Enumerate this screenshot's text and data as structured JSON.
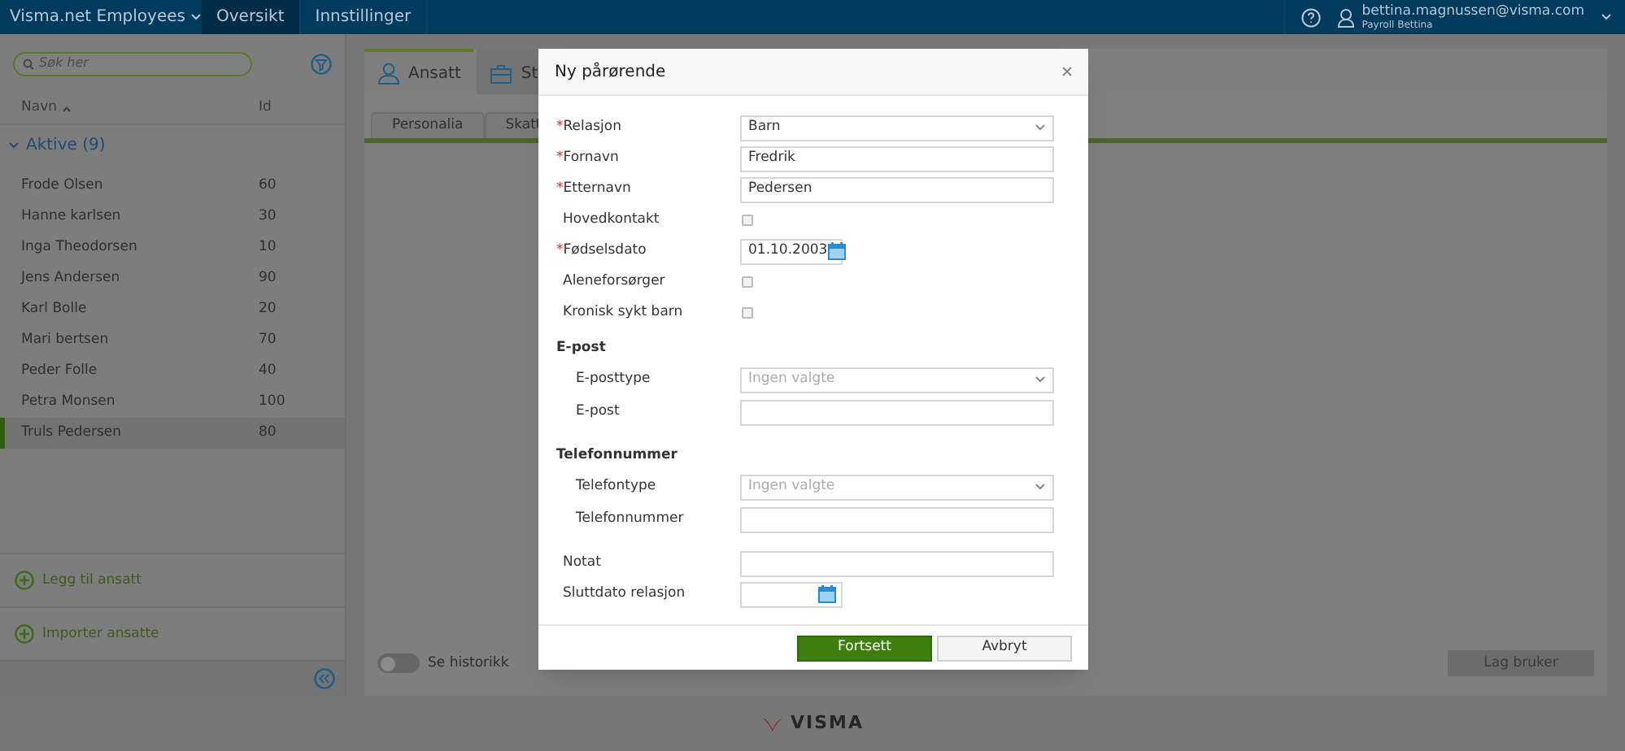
{
  "topbar": {
    "app_title": "Visma.net Employees",
    "nav": [
      {
        "label": "Oversikt",
        "selected": true
      },
      {
        "label": "Innstillinger",
        "selected": false
      }
    ],
    "user": {
      "email": "bettina.magnussen@visma.com",
      "name": "Payroll Bettina"
    }
  },
  "sidebar": {
    "search": {
      "placeholder": "Søk her"
    },
    "columns": [
      "Navn",
      "Id"
    ],
    "group": {
      "label": "Aktive (9)",
      "expanded": true
    },
    "rows": [
      {
        "name": "Frode Olsen",
        "id": "60",
        "selected": false
      },
      {
        "name": "Hanne karlsen",
        "id": "30",
        "selected": false
      },
      {
        "name": "Inga Theodorsen",
        "id": "10",
        "selected": false
      },
      {
        "name": "Jens Andersen",
        "id": "90",
        "selected": false
      },
      {
        "name": "Karl Bolle",
        "id": "20",
        "selected": false
      },
      {
        "name": "Mari bertsen",
        "id": "70",
        "selected": false
      },
      {
        "name": "Peder Folle",
        "id": "40",
        "selected": false
      },
      {
        "name": "Petra Monsen",
        "id": "100",
        "selected": false
      },
      {
        "name": "Truls Pedersen",
        "id": "80",
        "selected": true
      }
    ],
    "actions": [
      "Legg til ansatt",
      "Importer ansatte"
    ]
  },
  "main": {
    "tabs": [
      {
        "label": "Ansatt",
        "selected": true
      },
      {
        "label": "St",
        "selected": false
      }
    ],
    "subtabs": [
      "Personalia",
      "Skatt"
    ],
    "history_toggle": {
      "label": "Se historikk",
      "on": false
    },
    "create_user_button": {
      "label": "Lag bruker",
      "disabled": true
    }
  },
  "dialog": {
    "title": "Ny pårørende",
    "required_mark": "*",
    "sections": [
      {
        "fields": [
          {
            "kind": "select",
            "label": "Relasjon",
            "required": true,
            "value": "Barn"
          },
          {
            "kind": "text",
            "label": "Fornavn",
            "required": true,
            "value": "Fredrik"
          },
          {
            "kind": "text",
            "label": "Etternavn",
            "required": true,
            "value": "Pedersen"
          },
          {
            "kind": "checkbox",
            "label": "Hovedkontakt",
            "required": false,
            "checked": false
          },
          {
            "kind": "date",
            "label": "Fødselsdato",
            "required": true,
            "value": "01.10.2003"
          },
          {
            "kind": "checkbox",
            "label": "Aleneforsørger",
            "required": false,
            "checked": false
          },
          {
            "kind": "checkbox",
            "label": "Kronisk sykt barn",
            "required": false,
            "checked": false
          }
        ]
      },
      {
        "heading": "E-post",
        "fields": [
          {
            "kind": "select",
            "label": "E-posttype",
            "required": false,
            "placeholder": "Ingen valgte"
          },
          {
            "kind": "text",
            "label": "E-post",
            "required": false
          }
        ]
      },
      {
        "heading": "Telefonnummer",
        "fields": [
          {
            "kind": "select",
            "label": "Telefontype",
            "required": false,
            "placeholder": "Ingen valgte"
          },
          {
            "kind": "text",
            "label": "Telefonnummer",
            "required": false
          }
        ]
      },
      {
        "fields": [
          {
            "kind": "text",
            "label": "Notat",
            "required": false
          },
          {
            "kind": "date",
            "label": "Sluttdato relasjon",
            "required": false
          }
        ]
      }
    ],
    "buttons": [
      {
        "label": "Fortsett",
        "kind": "primary"
      },
      {
        "label": "Avbryt",
        "kind": "secondary"
      }
    ]
  },
  "footer": {
    "logo": "VISMA"
  }
}
